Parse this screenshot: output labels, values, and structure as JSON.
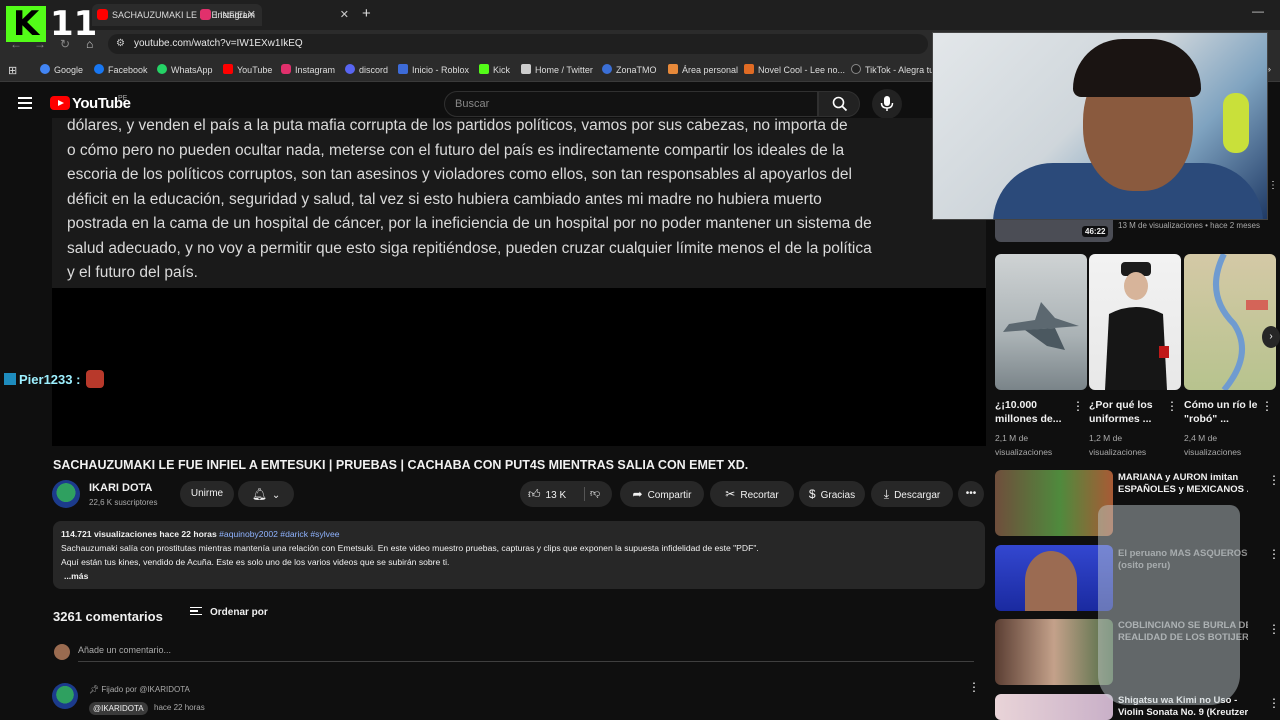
{
  "overlay": {
    "logo_letter": "K",
    "counter": "11"
  },
  "browser": {
    "tabs": [
      {
        "label": "SACHAUZUMAKI LE FUE INFIEL",
        "active": true
      },
      {
        "label": "Instagram",
        "active": false
      }
    ],
    "new_tab": "+",
    "url": "youtube.com/watch?v=IW1EXw1IkEQ",
    "bookmarks": [
      {
        "label": "Google",
        "color": "#4285f4"
      },
      {
        "label": "Facebook",
        "color": "#1877f2"
      },
      {
        "label": "WhatsApp",
        "color": "#25d366"
      },
      {
        "label": "YouTube",
        "color": "#ff0000"
      },
      {
        "label": "Instagram",
        "color": "#e1306c"
      },
      {
        "label": "discord",
        "color": "#5865f2"
      },
      {
        "label": "Inicio - Roblox",
        "color": "#3d6bd8"
      },
      {
        "label": "Kick",
        "color": "#53fc18"
      },
      {
        "label": "Home / Twitter",
        "color": "#cccccc"
      },
      {
        "label": "ZonaTMO",
        "color": "#3b6fd6"
      },
      {
        "label": "Área personal",
        "color": "#e7893a"
      },
      {
        "label": "Novel Cool - Lee no...",
        "color": "#e06b24"
      },
      {
        "label": "TikTok - Alegra tu",
        "color": "#222222"
      }
    ]
  },
  "youtube": {
    "logo_text": "YouTube",
    "region": "PE",
    "search_placeholder": "Buscar"
  },
  "video": {
    "lines": [
      "dólares, y venden el país a la puta mafia corrupta de los partidos políticos, vamos por sus cabezas, no importa de",
      "o cómo pero no pueden ocultar nada, meterse con el futuro del país es indirectamente compartir los ideales de la",
      "escoria de los políticos corruptos, son tan asesinos y violadores como ellos, son tan responsables al apoyarlos del",
      "déficit en la educación, seguridad y salud, tal vez si esto hubiera cambiado antes mi madre no hubiera muerto",
      "postrada en la cama de un hospital de cáncer, por la ineficiencia de un hospital por no poder mantener un sistema de",
      "salud adecuado, y no voy a permitir que esto siga repitiéndose, pueden cruzar cualquier límite menos el de la política",
      "y el futuro del país."
    ],
    "chat_user": "Pier1233 :"
  },
  "watch": {
    "title": "SACHAUZUMAKI LE FUE INFIEL A EMTESUKI | PRUEBAS | CACHABA CON PUT4S MIENTRAS SALIA CON EMET XD.",
    "channel": "IKARI DOTA",
    "subscribers": "22,6 K suscriptores",
    "join_label": "Unirme",
    "likes": "13 K",
    "share_label": "Compartir",
    "clip_label": "Recortar",
    "thanks_label": "Gracias",
    "download_label": "Descargar",
    "views": "114.721 visualizaciones",
    "uploaded": "hace 22 horas",
    "tags": "#aquinoby2002 #darick #sylvee",
    "description_1": "Sachauzumaki salía con prostitutas mientras mantenía una relación con Emetsuki. En este video muestro pruebas, capturas y clips que exponen la supuesta infidelidad de este \"PDF\".",
    "description_2": "Aquí están tus kines, vendido de Acuña. Este es solo uno de los varios videos que se subirán sobre ti.",
    "more": "...más"
  },
  "comments": {
    "count": "3261 comentarios",
    "sort_label": "Ordenar por",
    "add_placeholder": "Añade un comentario...",
    "pinned_label": "Fijado por @IKARIDOTA",
    "first_author": "@IKARIDOTA",
    "first_time": "hace 22 horas"
  },
  "sidebar": {
    "top_duration": "46:22",
    "top_meta": "13 M de visualizaciones • hace 2 meses",
    "shorts": [
      {
        "title": "¿¡10.000 millones de...",
        "views": "2,1 M de visualizaciones"
      },
      {
        "title": "¿Por qué los uniformes ...",
        "views": "1,2 M de visualizaciones"
      },
      {
        "title": "Cómo un río le \"robó\" ...",
        "views": "2,4 M de visualizaciones"
      }
    ],
    "recommended": [
      {
        "title_1": "MARIANA y AURON imitan",
        "title_2": "ESPAÑOLES y MEXICANOS ..."
      },
      {
        "title_1": "El peruano MAS ASQUEROSO",
        "title_2": "(osito peru)"
      },
      {
        "title_1": "COBLINCIANO SE BURLA DE LA",
        "title_2": "REALIDAD DE LOS BOTIJEROS..."
      },
      {
        "title_1": "Shigatsu wa Kimi no Uso -",
        "title_2": "Violin Sonata No. 9 (Kreutzer) ..."
      }
    ]
  }
}
